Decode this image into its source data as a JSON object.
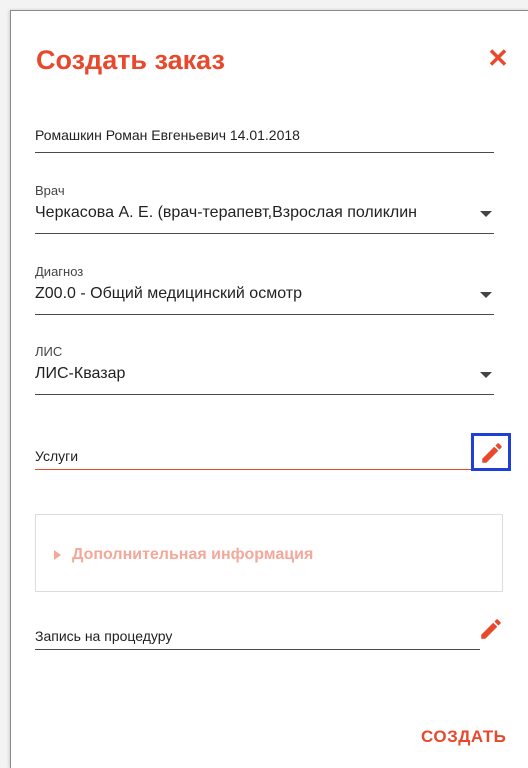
{
  "dialog": {
    "title": "Создать заказ",
    "close_icon": "close-icon",
    "accent_color": "#e8482c"
  },
  "patient": {
    "value": "Ромашкин Роман Евгеньевич 14.01.2018"
  },
  "doctor": {
    "label": "Врач",
    "value": "Черкасова А. Е. (врач-терапевт,Взрослая поликлин"
  },
  "diagnosis": {
    "label": "Диагноз",
    "value": "Z00.0 - Общий медицинский осмотр"
  },
  "lis": {
    "label": "ЛИС",
    "value": "ЛИС-Квазар"
  },
  "services": {
    "label": "Услуги",
    "edit_icon": "pencil-icon"
  },
  "extra_info": {
    "label": "Дополнительная информация",
    "expand_icon": "triangle-right-icon"
  },
  "procedure": {
    "label": "Запись на процедуру",
    "edit_icon": "pencil-icon"
  },
  "actions": {
    "create_label": "СОЗДАТЬ"
  }
}
